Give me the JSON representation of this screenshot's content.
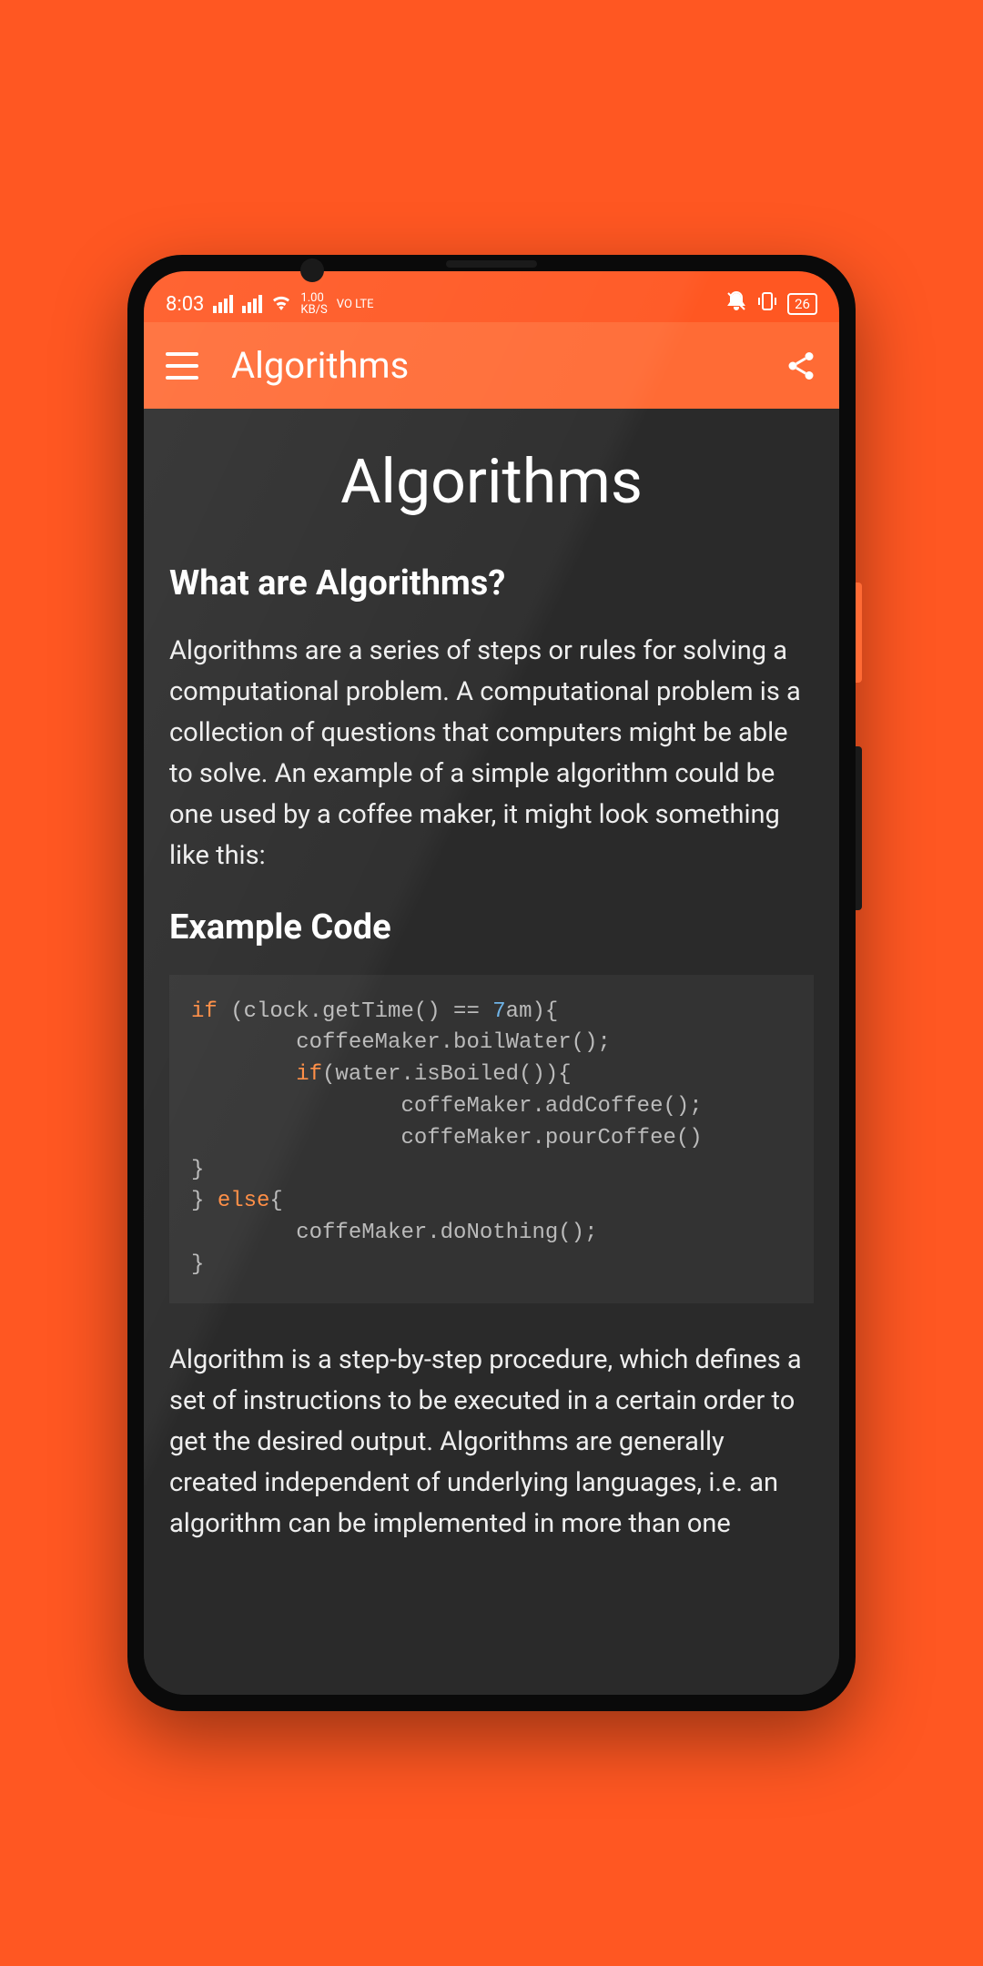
{
  "status": {
    "time": "8:03",
    "data_rate": "1.00",
    "data_unit": "KB/S",
    "volte": "VO LTE",
    "battery": "26"
  },
  "appbar": {
    "title": "Algorithms"
  },
  "content": {
    "page_title": "Algorithms",
    "heading1": "What are Algorithms?",
    "paragraph1": "Algorithms are a series of steps or rules for solving a computational problem. A computational problem is a collection of questions that computers might be able to solve. An example of a simple algorithm could be one used by a coffee maker, it might look something like this:",
    "heading2": "Example Code",
    "code": {
      "kw_if": "if",
      "l1_rest": " (clock.getTime() == ",
      "l1_num": "7",
      "l1_end": "am){",
      "l2": "        coffeeMaker.boilWater();",
      "l3_pad": "        ",
      "kw_if2": "if",
      "l3_rest": "(water.isBoiled()){",
      "l4": "                coffeMaker.addCoffee();",
      "l5": "                coffeMaker.pourCoffee()",
      "l6": "}",
      "l7_close": "} ",
      "kw_else": "else",
      "l7_rest": "{",
      "l8": "        coffeMaker.doNothing();",
      "l9": "}"
    },
    "paragraph2": "Algorithm is a step-by-step procedure, which defines a set of instructions to be executed in a certain order to get the desired output. Algorithms are generally created independent of underlying languages, i.e. an algorithm can be implemented in more than one"
  }
}
